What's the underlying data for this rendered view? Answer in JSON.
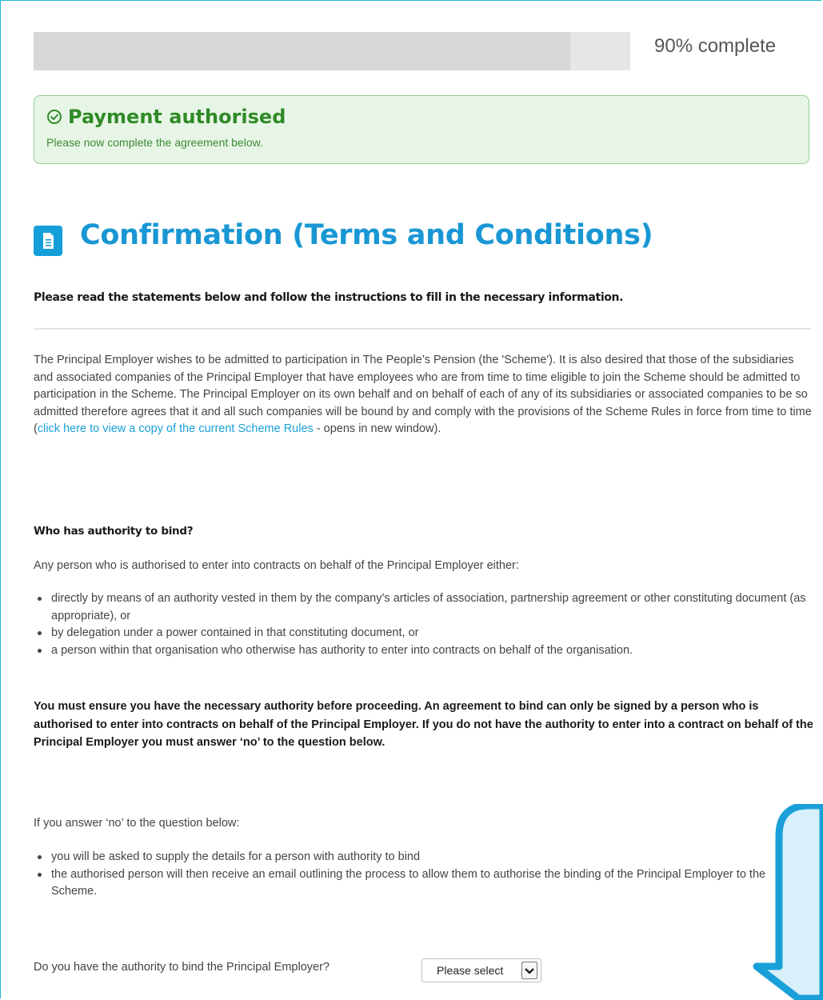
{
  "progress": {
    "percent": 90,
    "label": "90% complete"
  },
  "alert": {
    "title": "Payment authorised",
    "message": "Please now complete the agreement below.",
    "color": "#2f8a26"
  },
  "header": {
    "title": "Confirmation (Terms and Conditions)",
    "icon": "document-icon"
  },
  "intro": "Please read the statements below and follow the instructions to fill in the necessary information.",
  "agreement": {
    "text_before_link": "The Principal Employer wishes to be admitted to participation in The People’s Pension (the 'Scheme'). It is also desired that those of the subsidiaries and associated companies of the Principal Employer that have employees who are from time to time eligible to join the Scheme should be admitted to participation in the Scheme. The Principal Employer on its own behalf and on behalf of each of any of its subsidiaries or associated companies to be so admitted therefore agrees that it and all such companies will be bound by and comply with the provisions of the Scheme Rules in force from time to time (",
    "link_text": "click here to view a copy of the current Scheme Rules",
    "text_after_link": " - opens in new window)."
  },
  "authority": {
    "heading": "Who has authority to bind?",
    "intro": "Any person who is authorised to enter into contracts on behalf of the Principal Employer either:",
    "bullets": [
      "directly by means of an authority vested in them by the company’s articles of association, partnership agreement or other constituting document (as appropriate), or",
      "by delegation under a power contained in that constituting document, or",
      "a person within that organisation who otherwise has authority to enter into contracts on behalf of the organisation."
    ],
    "warning": "You must ensure you have the necessary authority before proceeding. An agreement to bind can only be signed by a person who is authorised to enter into contracts on behalf of the Principal Employer. If you do not have the authority to enter into a contract on behalf of the Principal Employer you must answer ‘no’ to the question below."
  },
  "if_no": {
    "intro": "If you answer ‘no’ to the question below:",
    "bullets": [
      "you will be asked to supply the details for a person with authority to bind",
      "the authorised person will then receive an email outlining the process to allow them to authorise the binding of the Principal Employer to the Scheme."
    ]
  },
  "question": {
    "label": "Do you have the authority to bind the Principal Employer?",
    "selected": "Please select"
  },
  "colors": {
    "accent": "#1997d4",
    "link": "#1aa0d8",
    "success_bg": "#e7f5e6",
    "success_border": "#8fcf8c",
    "bubble_fill": "#d8f0fa",
    "bubble_stroke": "#1aa0d8"
  }
}
